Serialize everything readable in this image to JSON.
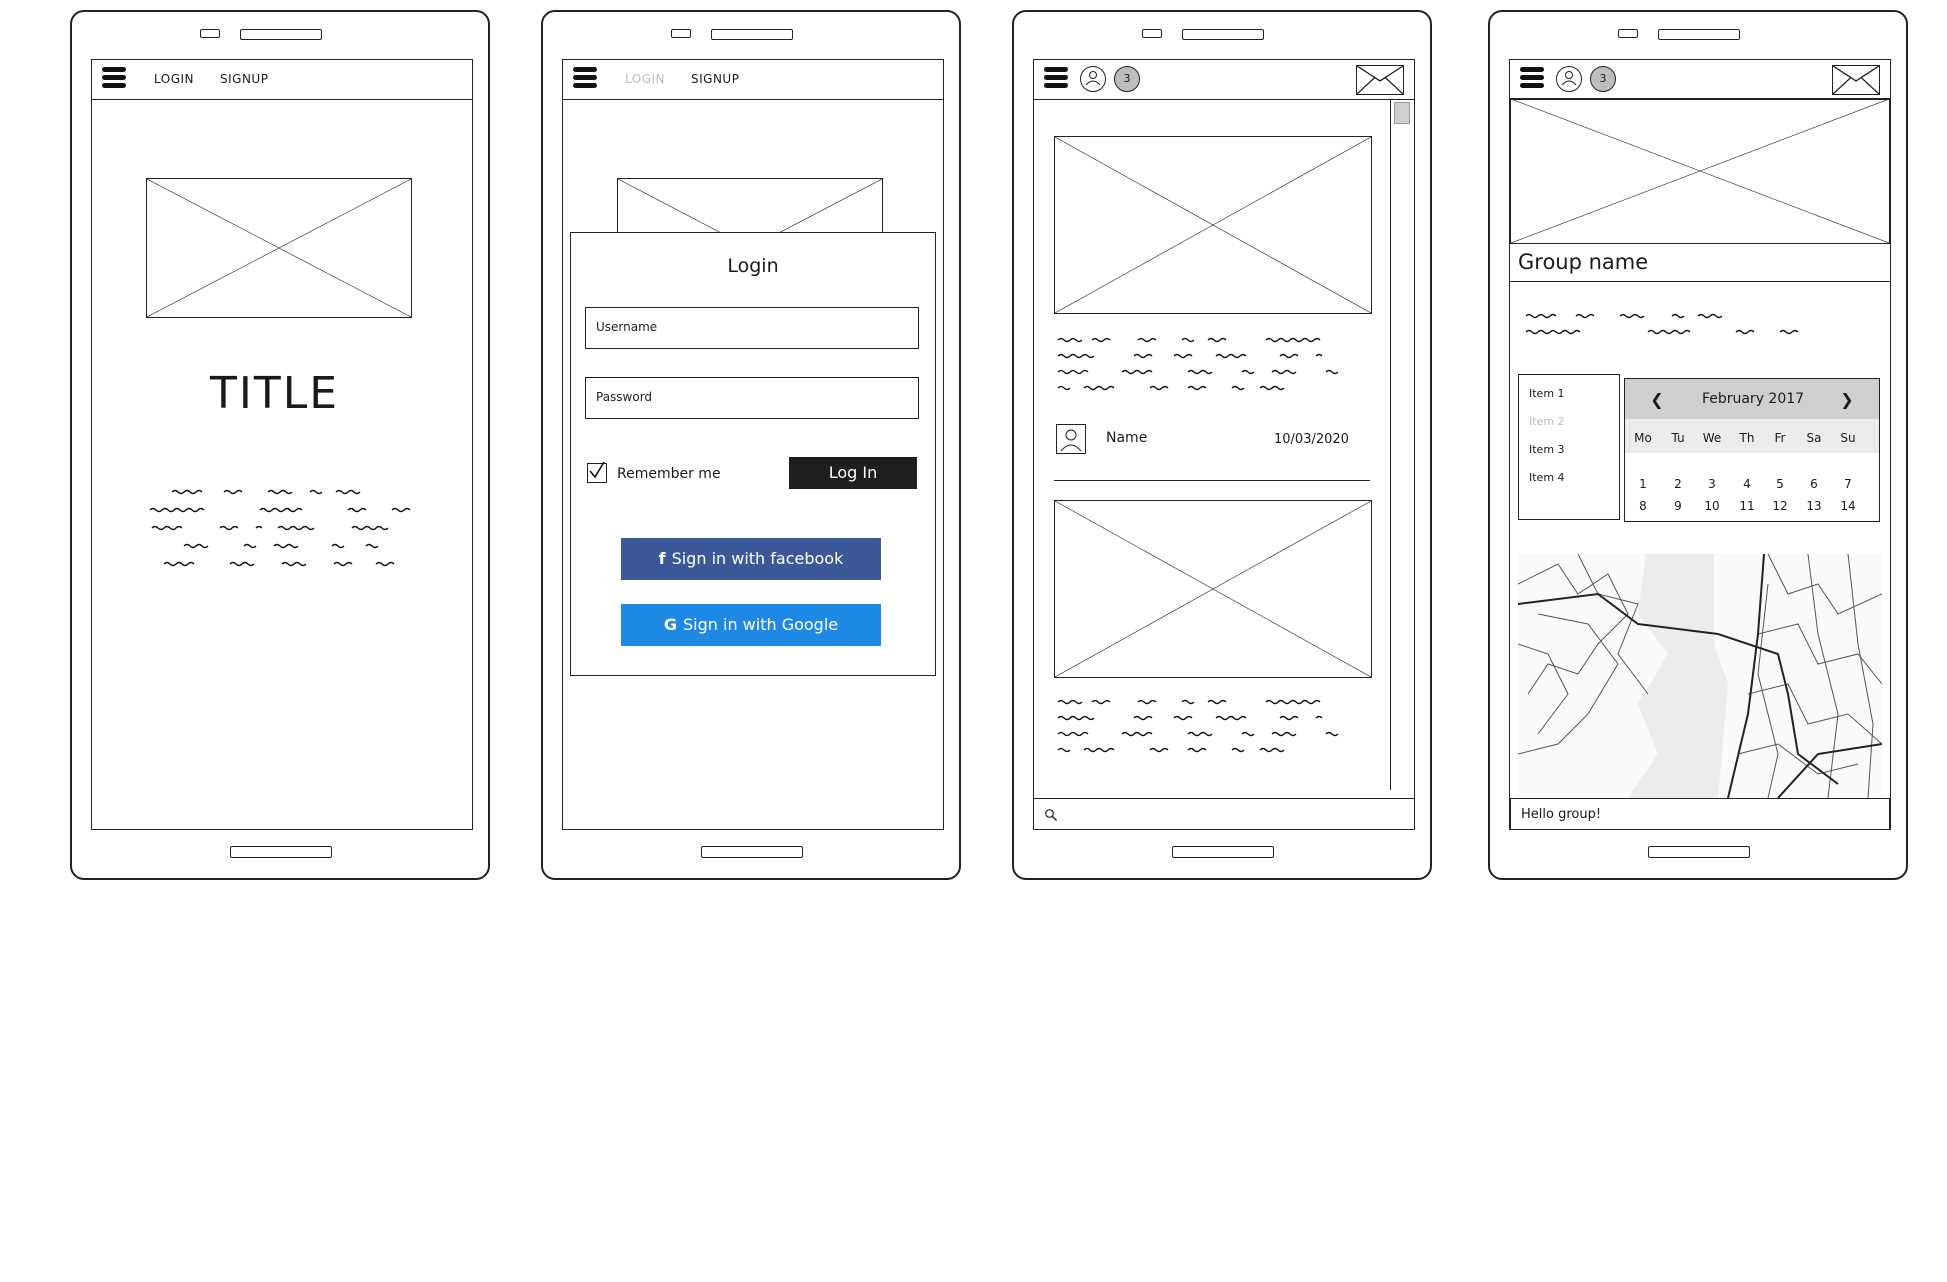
{
  "nav": {
    "login": "LOGIN",
    "signup": "SIGNUP"
  },
  "screen1": {
    "title": "TITLE"
  },
  "screen2": {
    "dialog_title": "Login",
    "username_placeholder": "Username",
    "password_placeholder": "Password",
    "remember_me": "Remember me",
    "login_button": "Log In",
    "facebook_button": "Sign in with facebook",
    "google_button": "Sign in with Google"
  },
  "screen3": {
    "notification_count": "3",
    "author_name": "Name",
    "post_date": "10/03/2020"
  },
  "screen4": {
    "notification_count": "3",
    "group_name": "Group name",
    "list_items": [
      {
        "label": "Item 1",
        "disabled": false
      },
      {
        "label": "Item 2",
        "disabled": true
      },
      {
        "label": "Item 3",
        "disabled": false
      },
      {
        "label": "Item 4",
        "disabled": false
      }
    ],
    "calendar": {
      "month": "February 2017",
      "prev": "❮",
      "next": "❯",
      "days_of_week": [
        "Mo",
        "Tu",
        "We",
        "Th",
        "Fr",
        "Sa",
        "Su"
      ],
      "week1": [
        "1",
        "2",
        "3",
        "4",
        "5",
        "6",
        "7"
      ],
      "week2": [
        "8",
        "9",
        "10",
        "11",
        "12",
        "13",
        "14"
      ]
    },
    "chat_input": "Hello group!"
  },
  "icons": {
    "menu": "hamburger-icon",
    "mail": "envelope-icon",
    "search": "search-icon",
    "user": "user-icon",
    "facebook": "facebook-icon",
    "google": "google-icon",
    "check": "check-icon"
  },
  "colors": {
    "facebook": "#3b5998",
    "google": "#1e88e5",
    "dark_button": "#1e1e1e",
    "calendar_header": "#cfcfcf"
  }
}
